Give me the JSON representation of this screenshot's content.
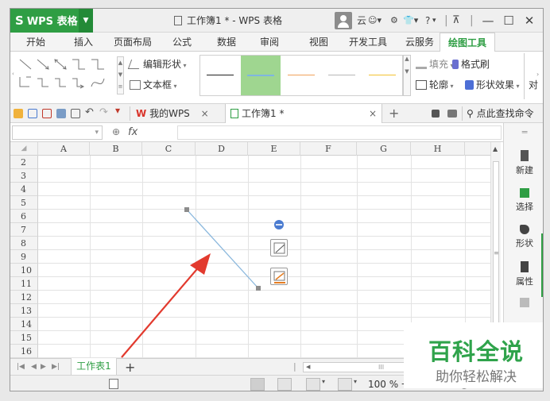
{
  "app": {
    "brand": "WPS 表格",
    "brand_glyph": "S",
    "doc_title": "工作簿1 * - WPS 表格"
  },
  "titlebar": {
    "cloud": "云",
    "help": "?"
  },
  "menu_tabs": [
    "开始",
    "插入",
    "页面布局",
    "公式",
    "数据",
    "审阅",
    "视图",
    "开发工具",
    "云服务",
    "绘图工具"
  ],
  "active_menu_tab": "绘图工具",
  "ribbon": {
    "edit_shape": "编辑形状",
    "text_box": "文本框",
    "fill": "填充",
    "format_painter": "格式刷",
    "outline": "轮廓",
    "shape_effects": "形状效果",
    "align_partial": "对",
    "line_styles": [
      {
        "color": "#222222"
      },
      {
        "color": "#7fb6e0"
      },
      {
        "color": "#f0a15a"
      },
      {
        "color": "#b7b7b7"
      },
      {
        "color": "#f2c230"
      }
    ]
  },
  "doc_tabs": {
    "home": "我的WPS",
    "active": "工作簿1 *",
    "new": "+"
  },
  "search": {
    "label": "点此查找命令"
  },
  "formula_bar": {
    "fx": "fx"
  },
  "columns": [
    "A",
    "B",
    "C",
    "D",
    "E",
    "F",
    "G",
    "H"
  ],
  "rows": [
    "2",
    "3",
    "4",
    "5",
    "6",
    "7",
    "8",
    "9",
    "10",
    "11",
    "12",
    "13",
    "14",
    "15",
    "16"
  ],
  "side_panel": {
    "new": "新建",
    "select": "选择",
    "shape": "形状",
    "properties": "属性"
  },
  "sheet": {
    "tab": "工作表1",
    "add": "+"
  },
  "status": {
    "zoom": "100 %"
  },
  "watermark": {
    "title": "百科全说",
    "subtitle": "助你轻松解决"
  },
  "colors": {
    "accent": "#2f9e44",
    "line": "#8bb8dd",
    "arrow": "#e23a2e"
  }
}
